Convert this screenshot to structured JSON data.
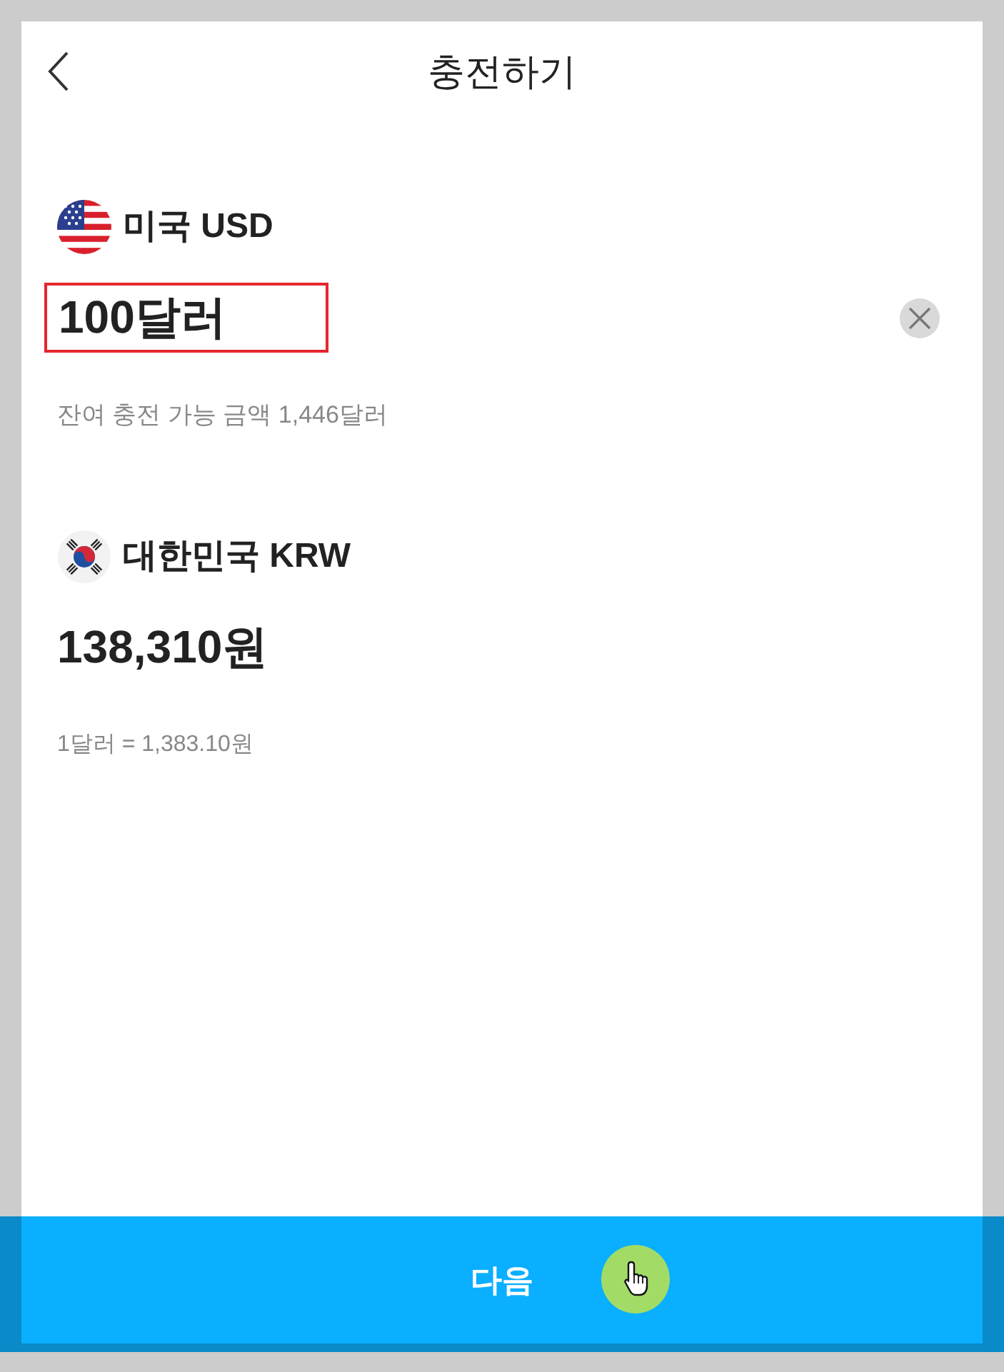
{
  "header": {
    "title": "충전하기"
  },
  "source": {
    "label": "미국 USD",
    "amount": "100달러",
    "highlighted": true,
    "note": "잔여 충전 가능 금액 1,446달러"
  },
  "target": {
    "label": "대한민국 KRW",
    "amount": "138,310원",
    "note": "1달러 = 1,383.10원"
  },
  "next_button": {
    "label": "다음",
    "pointer": true
  }
}
